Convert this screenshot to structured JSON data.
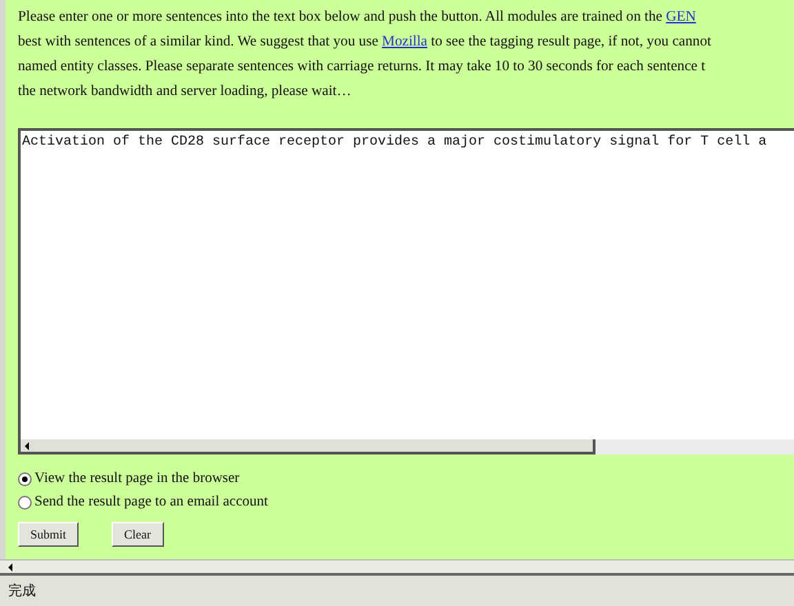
{
  "instructions": {
    "lines": [
      [
        {
          "kind": "text",
          "text": "Please enter one or more sentences into the text box below and push the button.  All modules are trained on the "
        },
        {
          "kind": "link",
          "text": "GEN"
        }
      ],
      [
        {
          "kind": "text",
          "text": "best with sentences of a similar kind. We suggest that you use "
        },
        {
          "kind": "link",
          "text": "Mozilla"
        },
        {
          "kind": "text",
          "text": " to see the tagging result page, if not, you cannot"
        }
      ],
      [
        {
          "kind": "text",
          "text": "named entity classes. Please separate sentences with carriage returns. It may take 10 to 30 seconds for each sentence t"
        }
      ],
      [
        {
          "kind": "text",
          "text": "the network bandwidth and server loading, please wait…"
        }
      ]
    ]
  },
  "text_box": {
    "value": "Activation of the CD28 surface receptor provides a major costimulatory signal for T cell a"
  },
  "options": [
    {
      "label": "View the result page in the browser",
      "selected": true
    },
    {
      "label": "Send the result page to an email account",
      "selected": false
    }
  ],
  "buttons": [
    "Submit",
    "Clear"
  ],
  "status_bar": {
    "text": "完成"
  }
}
